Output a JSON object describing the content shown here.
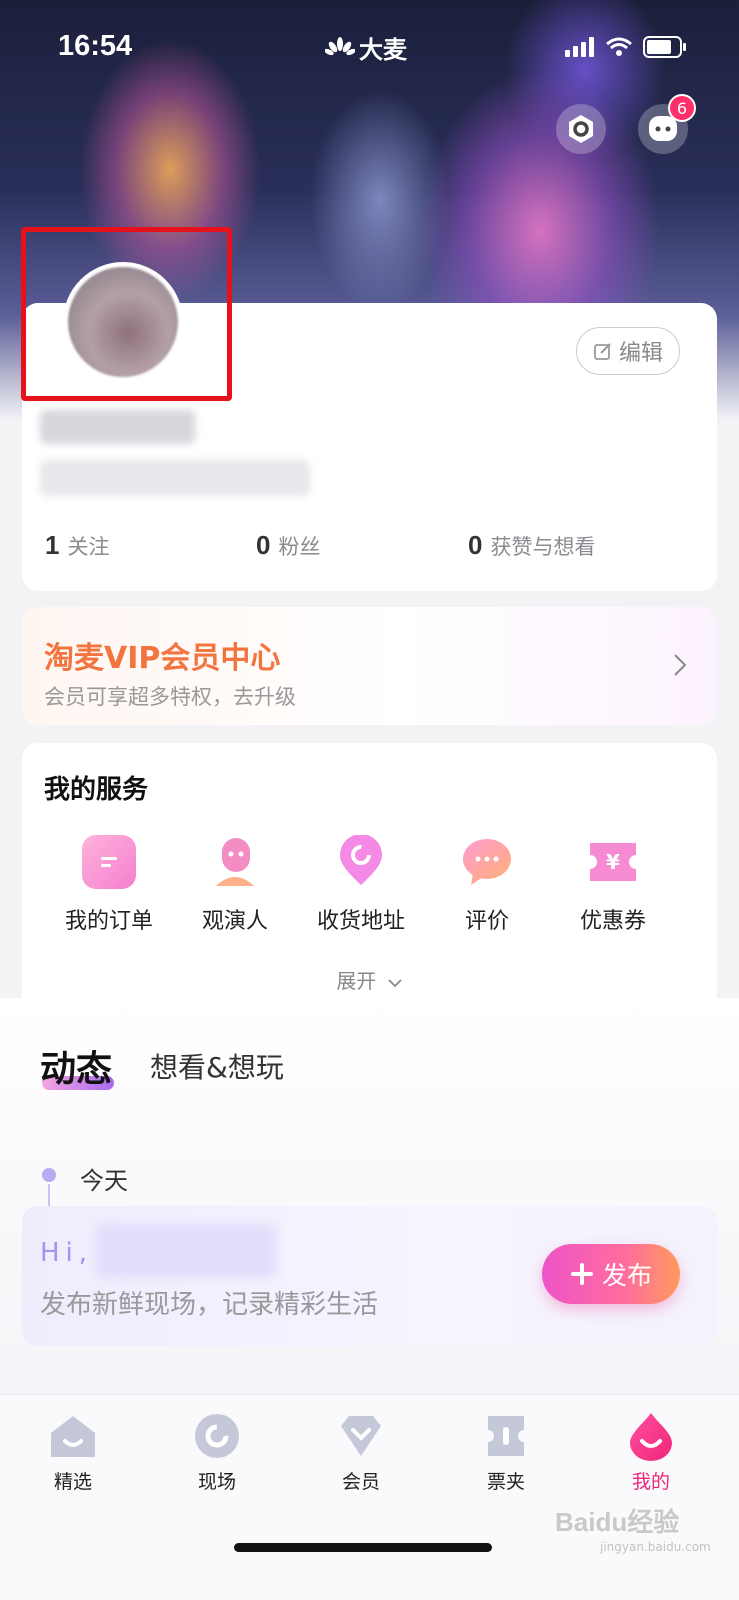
{
  "status_bar": {
    "time": "16:54",
    "brand": "大麦"
  },
  "header": {
    "message_badge": "6"
  },
  "profile": {
    "edit_label": "编辑",
    "stats": [
      {
        "num": "1",
        "label": "关注"
      },
      {
        "num": "0",
        "label": "粉丝"
      },
      {
        "num": "0",
        "label": "获赞与想看"
      }
    ]
  },
  "vip": {
    "title": "淘麦VIP会员中心",
    "subtitle": "会员可享超多特权，去升级"
  },
  "services": {
    "title": "我的服务",
    "items": [
      {
        "label": "我的订单",
        "icon": "order-icon"
      },
      {
        "label": "观演人",
        "icon": "viewer-icon"
      },
      {
        "label": "收货地址",
        "icon": "address-icon"
      },
      {
        "label": "评价",
        "icon": "comment-icon"
      },
      {
        "label": "优惠券",
        "icon": "coupon-icon"
      }
    ],
    "expand_label": "展开"
  },
  "feed": {
    "tab_active": "动态",
    "tab_other": "想看&想玩",
    "today": "今天",
    "hi": "Hi,",
    "post_prompt": "发布新鲜现场，记录精彩生活",
    "publish_label": "发布"
  },
  "tabbar": {
    "items": [
      {
        "label": "精选",
        "icon": "home-icon"
      },
      {
        "label": "现场",
        "icon": "live-icon"
      },
      {
        "label": "会员",
        "icon": "member-icon"
      },
      {
        "label": "票夹",
        "icon": "ticket-icon"
      },
      {
        "label": "我的",
        "icon": "me-icon",
        "active": true
      }
    ]
  },
  "watermark": {
    "text": "Baidu经验",
    "sub": "jingyan.baidu.com"
  },
  "colors": {
    "accent": "#ff2f6a",
    "vip_orange": "#f4743f",
    "highlight_red": "#e5121c",
    "purple": "#a691ee"
  }
}
